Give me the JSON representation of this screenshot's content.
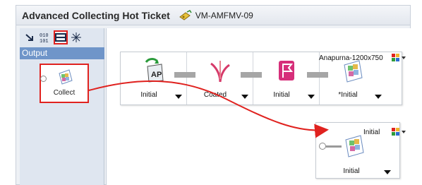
{
  "header": {
    "title": "Advanced Collecting Hot Ticket",
    "ticket_id": "VM-AMFMV-09"
  },
  "left_panel": {
    "toolbar": [
      {
        "icon": "arrow-icon"
      },
      {
        "icon": "binary-icon"
      },
      {
        "icon": "output-view-icon",
        "active": true
      },
      {
        "icon": "sparkle-icon"
      }
    ],
    "section_title": "Output",
    "collect_node": {
      "label": "Collect",
      "icon": "collect-output-icon"
    }
  },
  "workflow": {
    "chain": [
      {
        "label": "Initial",
        "icon": "ap-import-icon"
      },
      {
        "label": "Coated",
        "icon": "curve-icon"
      },
      {
        "label": "Initial",
        "icon": "flag-icon"
      },
      {
        "label": "*Initial",
        "icon": "output-target-icon"
      }
    ],
    "chain_tag": "Anapurna-1200x750",
    "second_node": {
      "tag": "Initial",
      "label": "Initial",
      "icon": "output-target-icon"
    }
  },
  "colors": {
    "highlight": "#e0221f",
    "header_blue": "#6f95c9",
    "panel_bg": "#dfe6f0"
  }
}
